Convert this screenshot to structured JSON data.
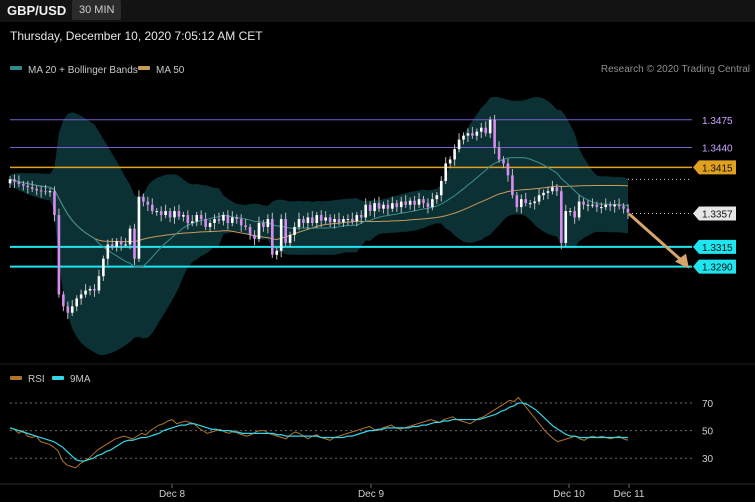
{
  "header": {
    "symbol": "GBP/USD",
    "timeframe": "30 MIN",
    "datetime": "Thursday, December 10, 2020 7:05:12 AM CET",
    "credit": "Research © 2020 Trading Central"
  },
  "colors": {
    "candle": "#ffffff",
    "band": "#0e3a3e",
    "ma20": "#3e8f8f",
    "ma50": "#c89a5a",
    "rsi": "#b0732e",
    "rsi_ma": "#33d6e6",
    "support": "#1ee6f0",
    "resistance": "#e0a020",
    "purple": "#7b5fd0",
    "arrow": "#d7a46a"
  },
  "chart_data": [
    {
      "type": "candlestick",
      "legend": [
        "MA 20 + Bollinger Bands",
        "MA 50"
      ],
      "ylim": [
        1.3175,
        1.3515
      ],
      "levels": [
        {
          "label": "1.3475",
          "value": 1.3475,
          "style": "purple"
        },
        {
          "label": "1.3440",
          "value": 1.344,
          "style": "purple"
        },
        {
          "label": "1.3415",
          "value": 1.3415,
          "style": "resistance"
        },
        {
          "label": "1.3357",
          "value": 1.3357,
          "style": "last"
        },
        {
          "label": "1.3315",
          "value": 1.3315,
          "style": "support"
        },
        {
          "label": "1.3290",
          "value": 1.329,
          "style": "support"
        }
      ],
      "close": [
        1.34,
        1.3397,
        1.3394,
        1.3392,
        1.339,
        1.3388,
        1.3386,
        1.3385,
        1.3384,
        1.3385,
        1.3355,
        1.3255,
        1.324,
        1.3232,
        1.324,
        1.325,
        1.3255,
        1.326,
        1.3262,
        1.326,
        1.3278,
        1.33,
        1.3318,
        1.3315,
        1.3322,
        1.3318,
        1.3318,
        1.3338,
        1.33,
        1.3378,
        1.3372,
        1.3368,
        1.336,
        1.336,
        1.3355,
        1.336,
        1.3352,
        1.336,
        1.3353,
        1.3355,
        1.3345,
        1.3347,
        1.3355,
        1.335,
        1.334,
        1.3345,
        1.335,
        1.3348,
        1.3355,
        1.3345,
        1.3352,
        1.335,
        1.3342,
        1.334,
        1.333,
        1.3325,
        1.3345,
        1.334,
        1.335,
        1.3305,
        1.331,
        1.335,
        1.332,
        1.333,
        1.334,
        1.335,
        1.3345,
        1.3352,
        1.3345,
        1.3355,
        1.3348,
        1.3352,
        1.3346,
        1.335,
        1.3346,
        1.335,
        1.335,
        1.3347,
        1.3355,
        1.3352,
        1.3368,
        1.336,
        1.337,
        1.3363,
        1.3368,
        1.3363,
        1.337,
        1.3365,
        1.3372,
        1.3368,
        1.3373,
        1.3368,
        1.3375,
        1.337,
        1.3365,
        1.3375,
        1.338,
        1.3398,
        1.342,
        1.3425,
        1.3438,
        1.345,
        1.3455,
        1.3458,
        1.3455,
        1.346,
        1.3465,
        1.3458,
        1.3475,
        1.344,
        1.3425,
        1.342,
        1.3405,
        1.338,
        1.3365,
        1.3375,
        1.337,
        1.337,
        1.3372,
        1.338,
        1.3383,
        1.3385,
        1.339,
        1.3385,
        1.332,
        1.336,
        1.336,
        1.3352,
        1.3372,
        1.3368,
        1.3368,
        1.3368,
        1.3365,
        1.3365,
        1.3368,
        1.3366,
        1.3368,
        1.3366,
        1.3363,
        1.3358
      ],
      "x_ticks": [
        "Dec 8",
        "Dec 9",
        "Dec 10",
        "Dec 11"
      ],
      "y_ticks": [
        "1.3475",
        "1.3440",
        "1.3415",
        "1.3357",
        "1.3315",
        "1.3290"
      ]
    },
    {
      "type": "line",
      "legend": [
        "RSI",
        "9MA"
      ],
      "ylim": [
        20,
        78
      ],
      "y_ticks": [
        70,
        50,
        30
      ],
      "rsi": [
        52,
        51,
        48,
        50,
        46,
        45,
        46,
        42,
        41,
        40,
        38,
        35,
        28,
        25,
        24,
        23,
        26,
        28,
        30,
        33,
        36,
        38,
        40,
        42,
        44,
        45,
        46,
        45,
        44,
        46,
        48,
        47,
        50,
        52,
        54,
        55,
        57,
        58,
        55,
        56,
        57,
        56,
        55,
        52,
        50,
        48,
        49,
        50,
        51,
        49,
        48,
        50,
        48,
        47,
        46,
        47,
        49,
        50,
        50,
        48,
        47,
        46,
        45,
        44,
        47,
        49,
        48,
        46,
        44,
        46,
        47,
        45,
        44,
        43,
        45,
        46,
        47,
        48,
        49,
        50,
        51,
        52,
        53,
        51,
        50,
        52,
        53,
        54,
        52,
        51,
        52,
        53,
        54,
        55,
        56,
        57,
        58,
        57,
        56,
        58,
        59,
        60,
        58,
        57,
        56,
        55,
        57,
        59,
        60,
        62,
        64,
        66,
        68,
        70,
        72,
        71,
        74,
        70,
        66,
        62,
        58,
        54,
        50,
        47,
        44,
        42,
        43,
        44,
        45,
        46,
        44,
        43,
        45,
        46,
        45,
        46,
        45,
        44,
        45,
        46,
        44,
        43
      ],
      "rsi_ma": [
        52,
        51,
        50,
        49,
        48,
        47,
        46,
        45,
        44,
        43,
        42,
        40,
        38,
        35,
        32,
        29,
        28,
        28,
        29,
        30,
        32,
        33,
        35,
        36,
        38,
        40,
        42,
        43,
        43,
        44,
        45,
        45,
        46,
        47,
        48,
        50,
        51,
        52,
        53,
        54,
        54,
        55,
        55,
        54,
        53,
        52,
        51,
        51,
        50,
        50,
        50,
        49,
        49,
        48,
        48,
        48,
        48,
        48,
        48,
        48,
        48,
        47,
        47,
        46,
        46,
        46,
        46,
        46,
        46,
        46,
        46,
        45,
        45,
        45,
        45,
        45,
        45,
        46,
        46,
        47,
        48,
        49,
        50,
        50,
        51,
        51,
        52,
        52,
        52,
        52,
        52,
        52,
        53,
        53,
        54,
        54,
        55,
        56,
        56,
        57,
        57,
        58,
        58,
        58,
        58,
        58,
        58,
        58,
        59,
        60,
        61,
        62,
        64,
        65,
        67,
        68,
        70,
        70,
        69,
        67,
        65,
        62,
        59,
        56,
        53,
        51,
        49,
        47,
        46,
        46,
        45,
        45,
        45,
        45,
        45,
        45,
        45,
        45,
        45,
        45,
        45,
        45
      ]
    }
  ]
}
